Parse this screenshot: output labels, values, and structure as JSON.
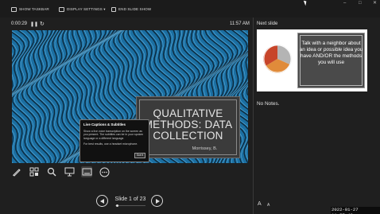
{
  "toolbar": {
    "show_taskbar": "SHOW TASKBAR",
    "display_settings": "DISPLAY SETTINGS ▾",
    "end_slide_show": "END SLIDE SHOW"
  },
  "window_controls": {
    "minimize": "–",
    "maximize": "□",
    "close": "✕"
  },
  "presenter": {
    "elapsed_time": "0:00:29",
    "pause_icon": "pause-icon",
    "reset_icon": "restart-icon",
    "clock": "11:57 AM"
  },
  "slide": {
    "title_line1": "QUALITATIVE",
    "title_line2": "METHODS: DATA",
    "title_line3": "COLLECTION",
    "author": "Morrissey, B.",
    "background_color": "#1a6fa0"
  },
  "captions_popup": {
    "title": "Live Captions & Subtitles",
    "body": "Show a live voice transcription on the screen as you present. The subtitles can be in your spoken language or a different language.",
    "tip": "For best results, use a headset microphone.",
    "button": "Got it"
  },
  "tools": [
    "pen-icon",
    "all-slides-icon",
    "zoom-icon",
    "pointer-icon",
    "subtitles-icon",
    "more-options-icon"
  ],
  "navigation": {
    "counter": "Slide 1 of 23",
    "prev_icon": "previous-slide-icon",
    "next_icon": "next-slide-icon"
  },
  "next_slide": {
    "label": "Next slide",
    "text_a": "Talk with a neighbor about an idea or",
    "text_em": "possible",
    "text_b": "idea you have AND/OR the methods you will use"
  },
  "notes": {
    "text": "No Notes."
  },
  "font_controls": {
    "increase": "A",
    "decrease": "A"
  },
  "timestamp": "2022-01-27  11:57:43"
}
